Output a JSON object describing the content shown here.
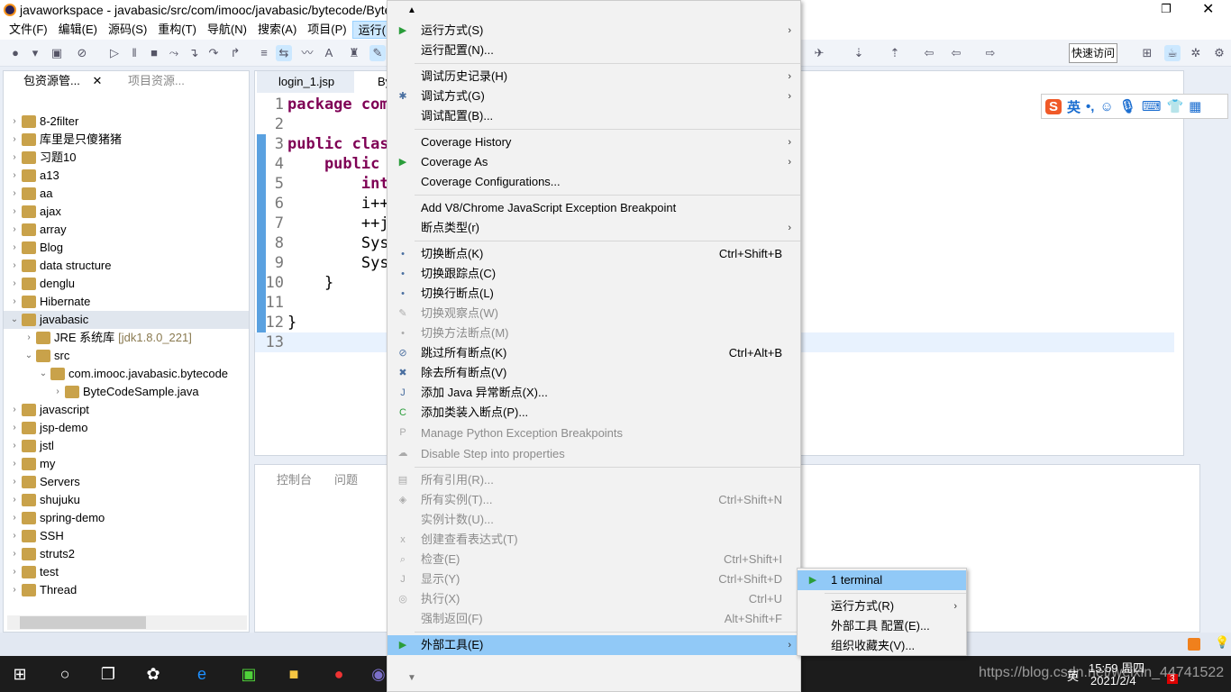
{
  "window": {
    "title": "javaworkspace - javabasic/src/com/imooc/javabasic/bytecode/ByteCode"
  },
  "menubar": [
    "文件(F)",
    "编辑(E)",
    "源码(S)",
    "重构(T)",
    "导航(N)",
    "搜索(A)",
    "项目(P)",
    "运行(R)"
  ],
  "toolbar": {
    "quick_access": "快速访问"
  },
  "left_panel": {
    "tabs": [
      "包资源管...",
      "项目资源..."
    ],
    "tree": [
      {
        "label": "8-2filter",
        "depth": 0,
        "expanded": false
      },
      {
        "label": "库里是只傻猪猪",
        "depth": 0,
        "expanded": false
      },
      {
        "label": "习题10",
        "depth": 0,
        "expanded": false
      },
      {
        "label": "a13",
        "depth": 0,
        "expanded": false
      },
      {
        "label": "aa",
        "depth": 0,
        "expanded": false
      },
      {
        "label": "ajax",
        "depth": 0,
        "expanded": false
      },
      {
        "label": "array",
        "depth": 0,
        "expanded": false
      },
      {
        "label": "Blog",
        "depth": 0,
        "expanded": false
      },
      {
        "label": "data structure",
        "depth": 0,
        "expanded": false
      },
      {
        "label": "denglu",
        "depth": 0,
        "expanded": false
      },
      {
        "label": "Hibernate",
        "depth": 0,
        "expanded": false
      },
      {
        "label": "javabasic",
        "depth": 0,
        "expanded": true,
        "selected": true
      },
      {
        "label": "JRE 系统库",
        "suffix": "[jdk1.8.0_221]",
        "depth": 1,
        "expanded": false
      },
      {
        "label": "src",
        "depth": 1,
        "expanded": true
      },
      {
        "label": "com.imooc.javabasic.bytecode",
        "depth": 2,
        "expanded": true
      },
      {
        "label": "ByteCodeSample.java",
        "depth": 3,
        "expanded": false
      },
      {
        "label": "javascript",
        "depth": 0,
        "expanded": false
      },
      {
        "label": "jsp-demo",
        "depth": 0,
        "expanded": false
      },
      {
        "label": "jstl",
        "depth": 0,
        "expanded": false
      },
      {
        "label": "my",
        "depth": 0,
        "expanded": false
      },
      {
        "label": "Servers",
        "depth": 0,
        "expanded": false
      },
      {
        "label": "shujuku",
        "depth": 0,
        "expanded": false
      },
      {
        "label": "spring-demo",
        "depth": 0,
        "expanded": false
      },
      {
        "label": "SSH",
        "depth": 0,
        "expanded": false
      },
      {
        "label": "struts2",
        "depth": 0,
        "expanded": false
      },
      {
        "label": "test",
        "depth": 0,
        "expanded": false
      },
      {
        "label": "Thread",
        "depth": 0,
        "expanded": false
      }
    ]
  },
  "editor": {
    "tabs": [
      "login_1.jsp",
      "By"
    ],
    "lines": [
      {
        "n": "1",
        "text": "package com"
      },
      {
        "n": "2",
        "text": ""
      },
      {
        "n": "3",
        "text": "public clas"
      },
      {
        "n": "4",
        "text": "    public"
      },
      {
        "n": "5",
        "text": "        int"
      },
      {
        "n": "6",
        "text": "        i++"
      },
      {
        "n": "7",
        "text": "        ++j"
      },
      {
        "n": "8",
        "text": "        Sys"
      },
      {
        "n": "9",
        "text": "        Sys"
      },
      {
        "n": "10",
        "text": "    }"
      },
      {
        "n": "11",
        "text": ""
      },
      {
        "n": "12",
        "text": "}"
      },
      {
        "n": "13",
        "text": ""
      }
    ]
  },
  "console": {
    "tabs": [
      "控制台",
      "问题"
    ]
  },
  "run_menu": [
    {
      "label": "运行方式(S)",
      "arrow": true,
      "icon": "run-icon"
    },
    {
      "label": "运行配置(N)..."
    },
    {
      "sep": true
    },
    {
      "label": "调试历史记录(H)",
      "arrow": true
    },
    {
      "label": "调试方式(G)",
      "arrow": true,
      "icon": "bug-icon"
    },
    {
      "label": "调试配置(B)..."
    },
    {
      "sep": true
    },
    {
      "label": "Coverage History",
      "arrow": true
    },
    {
      "label": "Coverage As",
      "arrow": true,
      "icon": "coverage-icon"
    },
    {
      "label": "Coverage Configurations..."
    },
    {
      "sep": true
    },
    {
      "label": "Add V8/Chrome JavaScript Exception Breakpoint"
    },
    {
      "label": "断点类型(r)",
      "arrow": true
    },
    {
      "sep": true
    },
    {
      "label": "切换断点(K)",
      "shortcut": "Ctrl+Shift+B",
      "icon": "breakpoint-icon"
    },
    {
      "label": "切换跟踪点(C)",
      "icon": "breakpoint-icon"
    },
    {
      "label": "切换行断点(L)",
      "icon": "breakpoint-icon"
    },
    {
      "label": "切换观察点(W)",
      "disabled": true,
      "icon": "watchpoint-icon"
    },
    {
      "label": "切换方法断点(M)",
      "disabled": true,
      "icon": "breakpoint-icon"
    },
    {
      "label": "跳过所有断点(K)",
      "shortcut": "Ctrl+Alt+B",
      "icon": "skip-breakpoints-icon"
    },
    {
      "label": "除去所有断点(V)",
      "icon": "remove-all-icon"
    },
    {
      "label": "添加 Java 异常断点(X)...",
      "icon": "java-exception-icon"
    },
    {
      "label": "添加类装入断点(P)...",
      "icon": "class-load-icon"
    },
    {
      "label": "Manage Python Exception Breakpoints",
      "disabled": true,
      "tall": true,
      "icon": "python-icon"
    },
    {
      "label": "Disable Step into properties",
      "disabled": true,
      "tall": true,
      "icon": "step-icon"
    },
    {
      "sep": true
    },
    {
      "label": "所有引用(R)...",
      "disabled": true,
      "icon": "references-icon"
    },
    {
      "label": "所有实例(T)...",
      "shortcut": "Ctrl+Shift+N",
      "disabled": true,
      "icon": "instances-icon"
    },
    {
      "label": "实例计数(U)...",
      "disabled": true
    },
    {
      "label": "创建查看表达式(T)",
      "disabled": true,
      "icon": "watch-expression-icon"
    },
    {
      "label": "检查(E)",
      "shortcut": "Ctrl+Shift+I",
      "disabled": true,
      "icon": "inspect-icon"
    },
    {
      "label": "显示(Y)",
      "shortcut": "Ctrl+Shift+D",
      "disabled": true,
      "icon": "display-icon"
    },
    {
      "label": "执行(X)",
      "shortcut": "Ctrl+U",
      "disabled": true,
      "icon": "execute-icon"
    },
    {
      "label": "强制返回(F)",
      "shortcut": "Alt+Shift+F",
      "disabled": true
    },
    {
      "sep": true
    },
    {
      "label": "外部工具(E)",
      "arrow": true,
      "highlighted": true,
      "icon": "external-tools-icon"
    }
  ],
  "submenu": [
    {
      "label": "1 terminal",
      "highlighted": true,
      "icon": "external-tools-icon"
    },
    {
      "sep": true
    },
    {
      "label": "运行方式(R)",
      "arrow": true
    },
    {
      "label": "外部工具 配置(E)..."
    },
    {
      "label": "组织收藏夹(V)..."
    }
  ],
  "ime": {
    "mode": "英"
  },
  "taskbar": {
    "time": "15:59 周四",
    "date": "2021/2/4",
    "tray_lang": "英",
    "badge": "3"
  },
  "watermark": "https://blog.csdn.net/weixin_44741522",
  "colors": {
    "highlight": "#91c9f7",
    "menu_bg": "#f2f2f2",
    "selection": "#cce8ff",
    "keyword": "#7f0055"
  }
}
